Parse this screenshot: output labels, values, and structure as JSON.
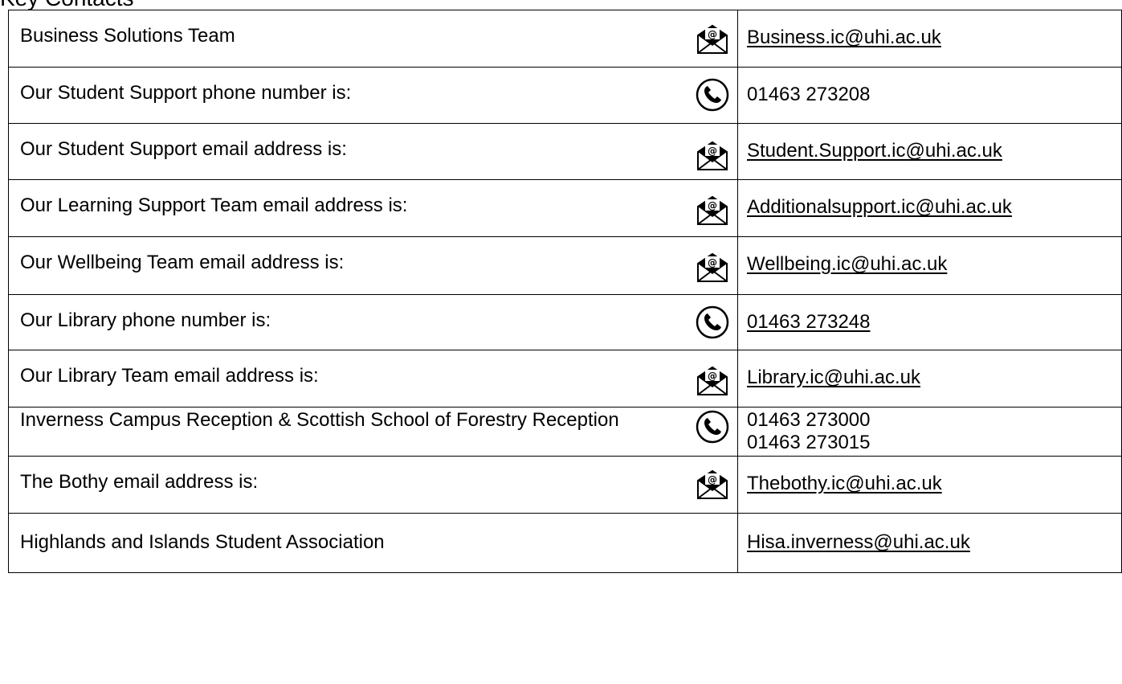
{
  "heading": "Key Contacts",
  "rows": [
    {
      "label": "Business Solutions Team",
      "icon": "email-icon",
      "value": "Business.ic@uhi.ac.uk",
      "value_type": "link"
    },
    {
      "label": "Our Student Support phone number is:",
      "icon": "phone-icon",
      "value": "01463 273208",
      "value_type": "text"
    },
    {
      "label": "Our Student Support email address is:",
      "icon": "email-icon",
      "value": "Student.Support.ic@uhi.ac.uk",
      "value_type": "link"
    },
    {
      "label": "Our Learning Support Team email address is:",
      "icon": "email-icon",
      "value": "Additionalsupport.ic@uhi.ac.uk",
      "value_type": "link"
    },
    {
      "label": "Our Wellbeing Team email address is:",
      "icon": "email-icon",
      "value": "Wellbeing.ic@uhi.ac.uk",
      "value_type": "link"
    },
    {
      "label": "Our Library phone number is:",
      "icon": "phone-icon",
      "value": "01463 273248",
      "value_type": "link"
    },
    {
      "label": "Our Library Team email address is:",
      "icon": "email-icon",
      "value": "Library.ic@uhi.ac.uk",
      "value_type": "link"
    },
    {
      "label": "Inverness Campus Reception &  Scottish School of Forestry Reception",
      "icon": "phone-icon",
      "value": "01463 273000",
      "value_2": "01463 273015",
      "value_type": "text"
    },
    {
      "label": "The Bothy email address is:",
      "icon": "email-icon",
      "value": "Thebothy.ic@uhi.ac.uk",
      "value_type": "link"
    },
    {
      "label": "Highlands and Islands Student Association",
      "icon": "",
      "value": "Hisa.inverness@uhi.ac.uk",
      "value_type": "link"
    }
  ]
}
